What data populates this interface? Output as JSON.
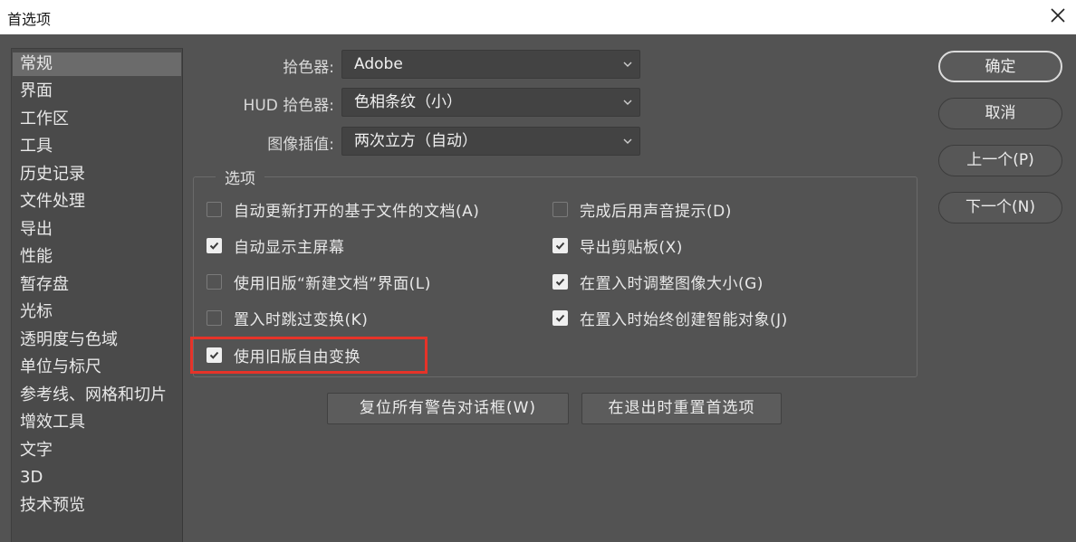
{
  "window": {
    "title": "首选项"
  },
  "sidebar": {
    "items": [
      {
        "label": "常规"
      },
      {
        "label": "界面"
      },
      {
        "label": "工作区"
      },
      {
        "label": "工具"
      },
      {
        "label": "历史记录"
      },
      {
        "label": "文件处理"
      },
      {
        "label": "导出"
      },
      {
        "label": "性能"
      },
      {
        "label": "暂存盘"
      },
      {
        "label": "光标"
      },
      {
        "label": "透明度与色域"
      },
      {
        "label": "单位与标尺"
      },
      {
        "label": "参考线、网格和切片"
      },
      {
        "label": "增效工具"
      },
      {
        "label": "文字"
      },
      {
        "label": "3D"
      },
      {
        "label": "技术预览"
      }
    ],
    "selected": "常规"
  },
  "fields": {
    "color_picker": {
      "label": "拾色器:",
      "value": "Adobe"
    },
    "hud_color_picker": {
      "label": "HUD 拾色器:",
      "value": "色相条纹（小）"
    },
    "image_interpolation": {
      "label": "图像插值:",
      "value": "两次立方（自动）"
    }
  },
  "options": {
    "legend": "选项",
    "left": [
      {
        "label": "自动更新打开的基于文件的文档(A)",
        "checked": false
      },
      {
        "label": "自动显示主屏幕",
        "checked": true
      },
      {
        "label": "使用旧版“新建文档”界面(L)",
        "checked": false
      },
      {
        "label": "置入时跳过变换(K)",
        "checked": false
      },
      {
        "label": "使用旧版自由变换",
        "checked": true
      }
    ],
    "right": [
      {
        "label": "完成后用声音提示(D)",
        "checked": false
      },
      {
        "label": "导出剪贴板(X)",
        "checked": true
      },
      {
        "label": "在置入时调整图像大小(G)",
        "checked": true
      },
      {
        "label": "在置入时始终创建智能对象(J)",
        "checked": true
      }
    ]
  },
  "actions": {
    "reset_warnings": "复位所有警告对话框(W)",
    "reset_on_quit": "在退出时重置首选项"
  },
  "dialog_buttons": {
    "ok": "确定",
    "cancel": "取消",
    "prev": "上一个(P)",
    "next": "下一个(N)"
  },
  "colors": {
    "panel": "#535353",
    "highlight": "#e63329"
  }
}
